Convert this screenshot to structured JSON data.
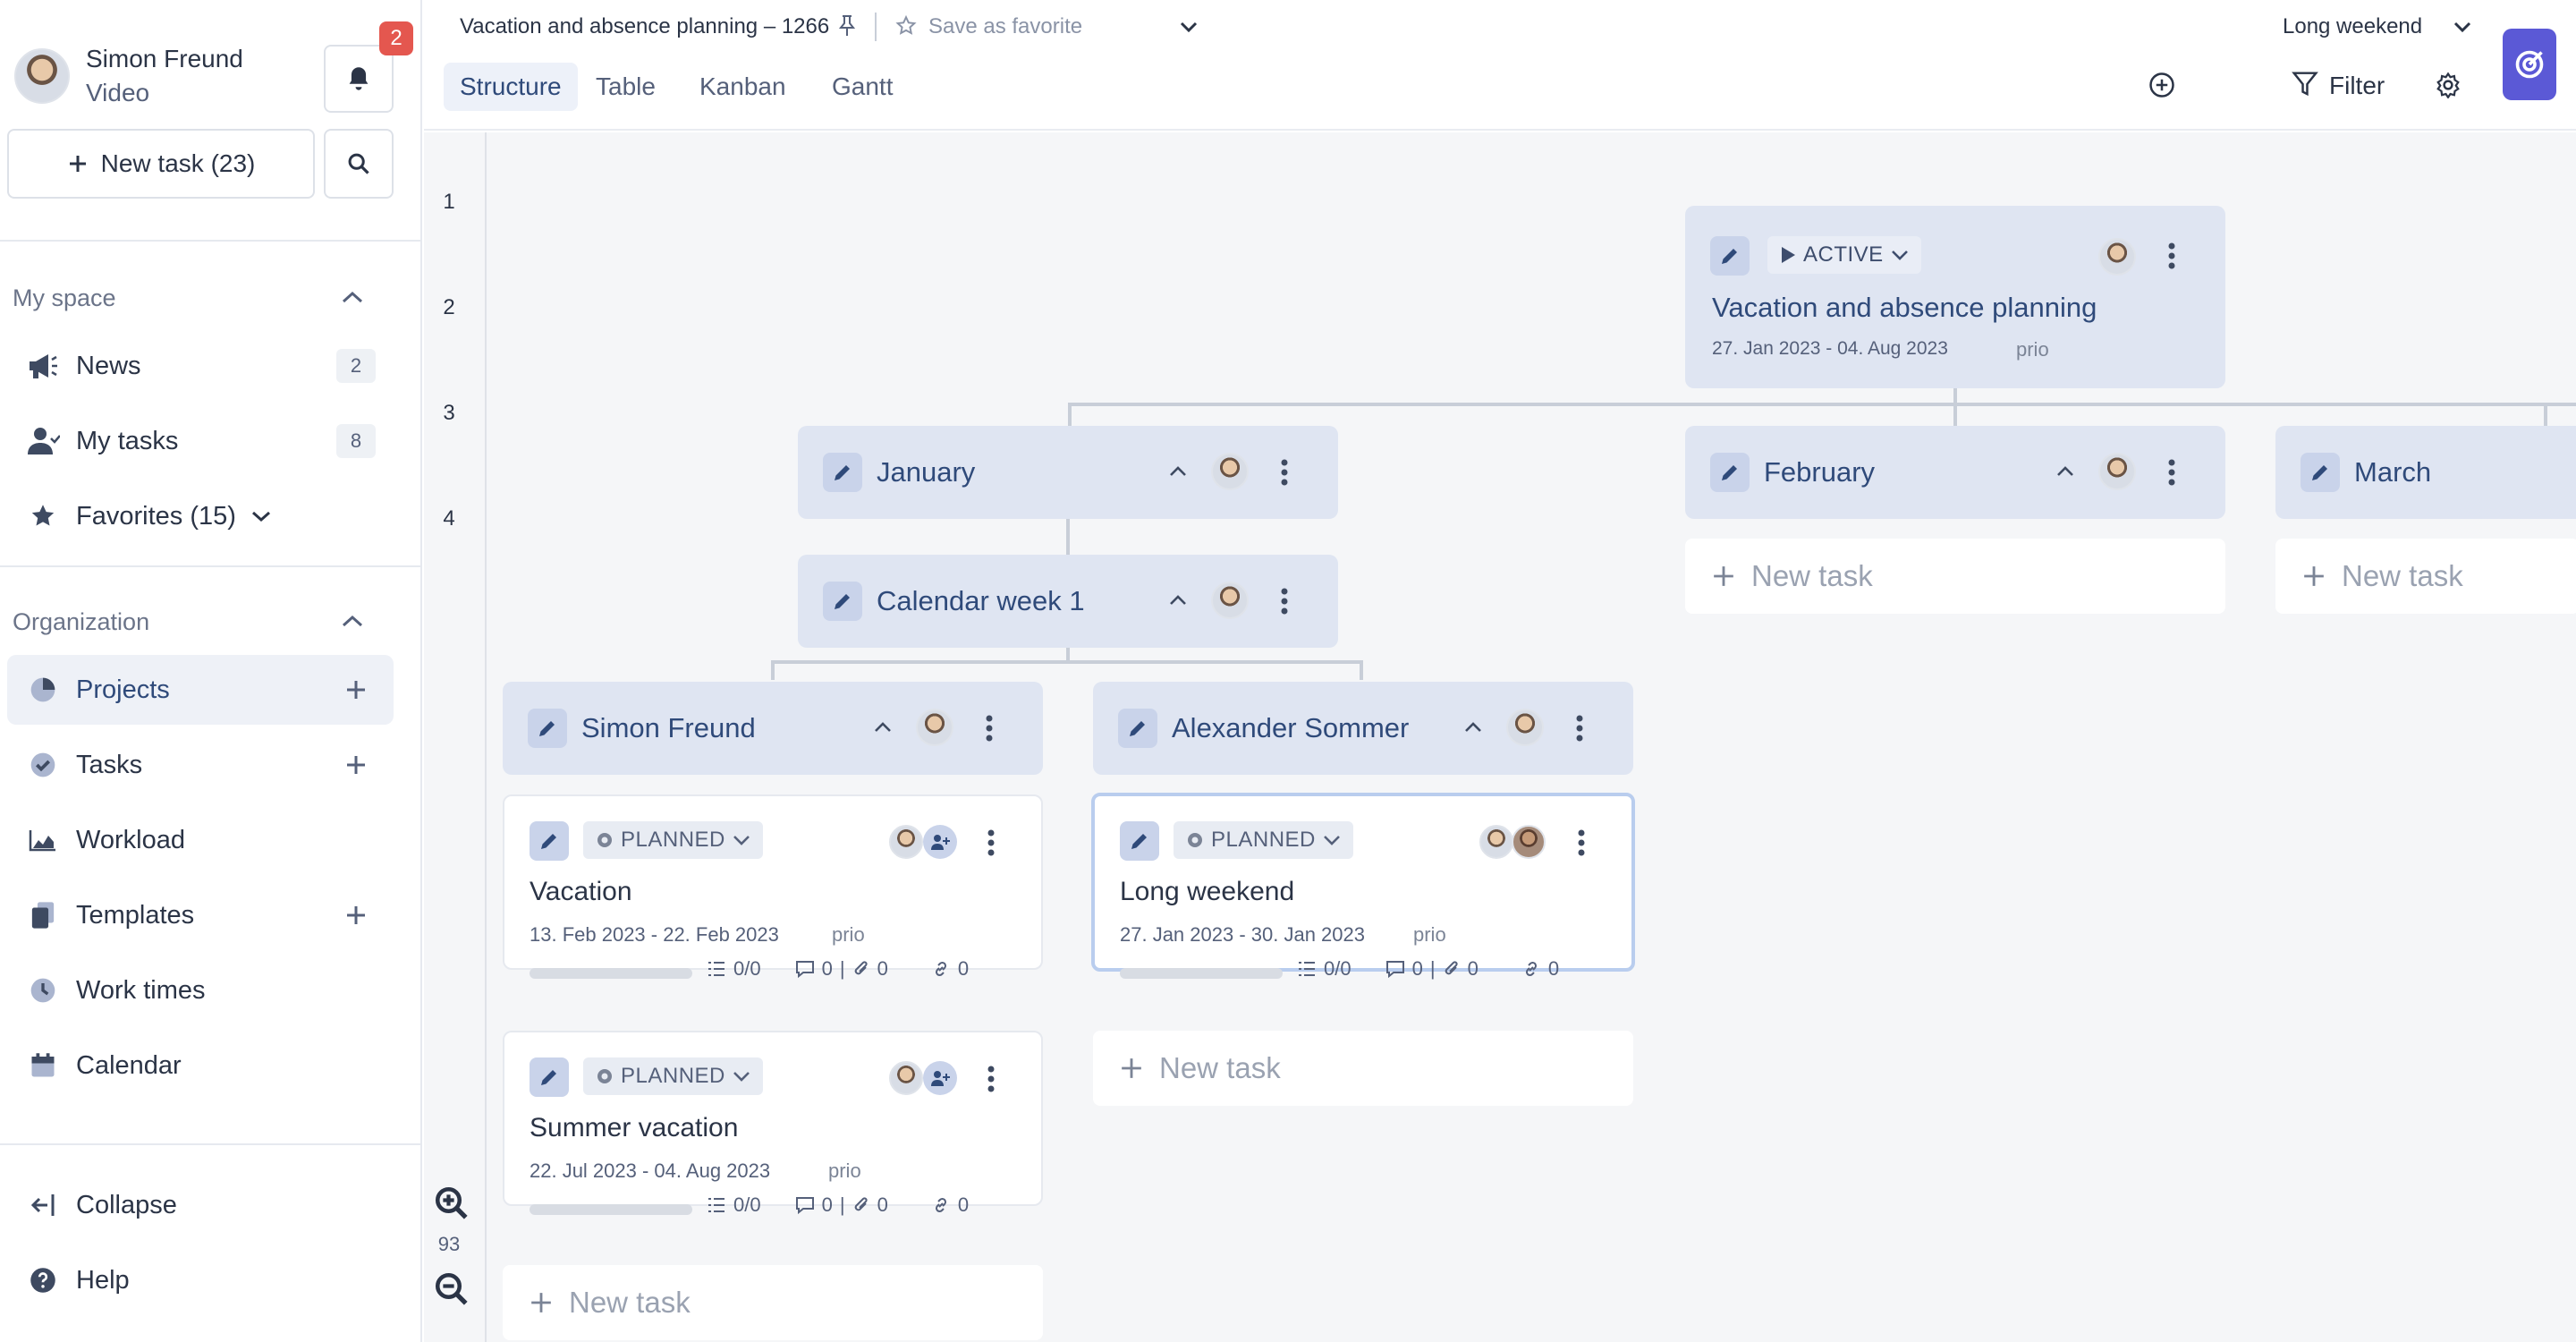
{
  "user": {
    "name": "Simon Freund",
    "subtitle": "Video",
    "notifications": "2"
  },
  "sidebar": {
    "new_task_label": "New task (23)",
    "my_space_title": "My space",
    "my_space_items": [
      {
        "label": "News",
        "count": "2",
        "icon": "megaphone-icon"
      },
      {
        "label": "My tasks",
        "count": "8",
        "icon": "user-icon"
      },
      {
        "label": "Favorites (15)",
        "icon": "star-icon"
      }
    ],
    "organization_title": "Organization",
    "organization_items": [
      {
        "label": "Projects",
        "icon": "pie-chart-icon",
        "active": true
      },
      {
        "label": "Tasks",
        "icon": "check-circle-icon"
      },
      {
        "label": "Workload",
        "icon": "area-chart-icon"
      },
      {
        "label": "Templates",
        "icon": "copy-icon"
      },
      {
        "label": "Work times",
        "icon": "clock-icon"
      },
      {
        "label": "Calendar",
        "icon": "calendar-icon"
      }
    ],
    "collapse_label": "Collapse",
    "help_label": "Help"
  },
  "topbar": {
    "breadcrumb": "Vacation and absence planning – 1266",
    "favorite_label": "Save as favorite",
    "tabs": [
      "Structure",
      "Table",
      "Kanban",
      "Gantt"
    ],
    "active_tab": "Structure",
    "view_select": "Long weekend",
    "filter_label": "Filter"
  },
  "canvas": {
    "ruler": [
      "1",
      "2",
      "3",
      "4"
    ],
    "zoom": "93",
    "root": {
      "status": "ACTIVE",
      "title": "Vacation and absence planning",
      "dates": "27. Jan 2023 - 04. Aug 2023",
      "prio": "prio"
    },
    "months": [
      {
        "title": "January"
      },
      {
        "title": "February"
      },
      {
        "title": "March"
      }
    ],
    "week": {
      "title": "Calendar week 1"
    },
    "people": [
      {
        "title": "Simon Freund"
      },
      {
        "title": "Alexander Sommer"
      }
    ],
    "tasks": [
      {
        "status": "PLANNED",
        "title": "Vacation",
        "dates": "13. Feb 2023 - 22. Feb 2023",
        "prio": "prio",
        "checklist": "0/0",
        "comments": "0",
        "attachments": "0",
        "links": "0"
      },
      {
        "status": "PLANNED",
        "title": "Summer vacation",
        "dates": "22. Jul 2023 - 04. Aug 2023",
        "prio": "prio",
        "checklist": "0/0",
        "comments": "0",
        "attachments": "0",
        "links": "0"
      },
      {
        "status": "PLANNED",
        "title": "Long weekend",
        "dates": "27. Jan 2023 - 30. Jan 2023",
        "prio": "prio",
        "checklist": "0/0",
        "comments": "0",
        "attachments": "0",
        "links": "0"
      }
    ],
    "new_task_label": "New task"
  },
  "colors": {
    "accent": "#2f4a7a",
    "card_bg": "#dfe5f2",
    "launcher": "#5b59d6",
    "badge": "#e4574f"
  }
}
